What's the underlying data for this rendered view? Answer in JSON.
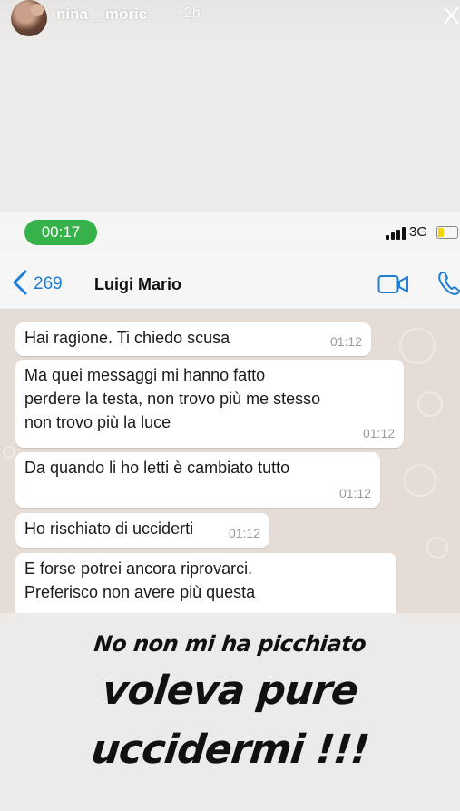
{
  "story": {
    "username": "nina__moric",
    "time_ago": "2h",
    "close_icon": "close-icon"
  },
  "status_bar": {
    "call_timer": "00:17",
    "network": "3G",
    "signal_icon": "signal-bars-icon",
    "battery_icon": "battery-icon",
    "call_color": "#35b34a",
    "battery_color": "#f5d300"
  },
  "chat_header": {
    "back_count": "269",
    "contact_name": "Luigi Mario",
    "back_icon": "chevron-left-icon",
    "video_icon": "video-call-icon",
    "phone_icon": "phone-icon",
    "accent_color": "#1e7ed6"
  },
  "messages": [
    {
      "text": "Hai ragione. Ti chiedo scusa",
      "time": "01:12"
    },
    {
      "text": "Ma quei messaggi mi hanno fatto perdere la testa, non trovo più me stesso non trovo più la luce",
      "lines": [
        "Ma quei messaggi mi hanno fatto",
        "perdere la testa, non trovo più me stesso",
        "non trovo più la luce"
      ],
      "time": "01:12"
    },
    {
      "text": "Da quando li ho letti è cambiato tutto",
      "time": "01:12"
    },
    {
      "text": "Ho rischiato di ucciderti",
      "time": "01:12"
    },
    {
      "text": "E forse potrei ancora riprovarci. Preferisco non avere più questa",
      "lines": [
        "E forse potrei ancora riprovarci.",
        "Preferisco non avere più questa"
      ],
      "time": ""
    }
  ],
  "caption": {
    "line1": "No non mi ha picchiato",
    "line2": "voleva pure",
    "line3": "uccidermi !!!"
  }
}
